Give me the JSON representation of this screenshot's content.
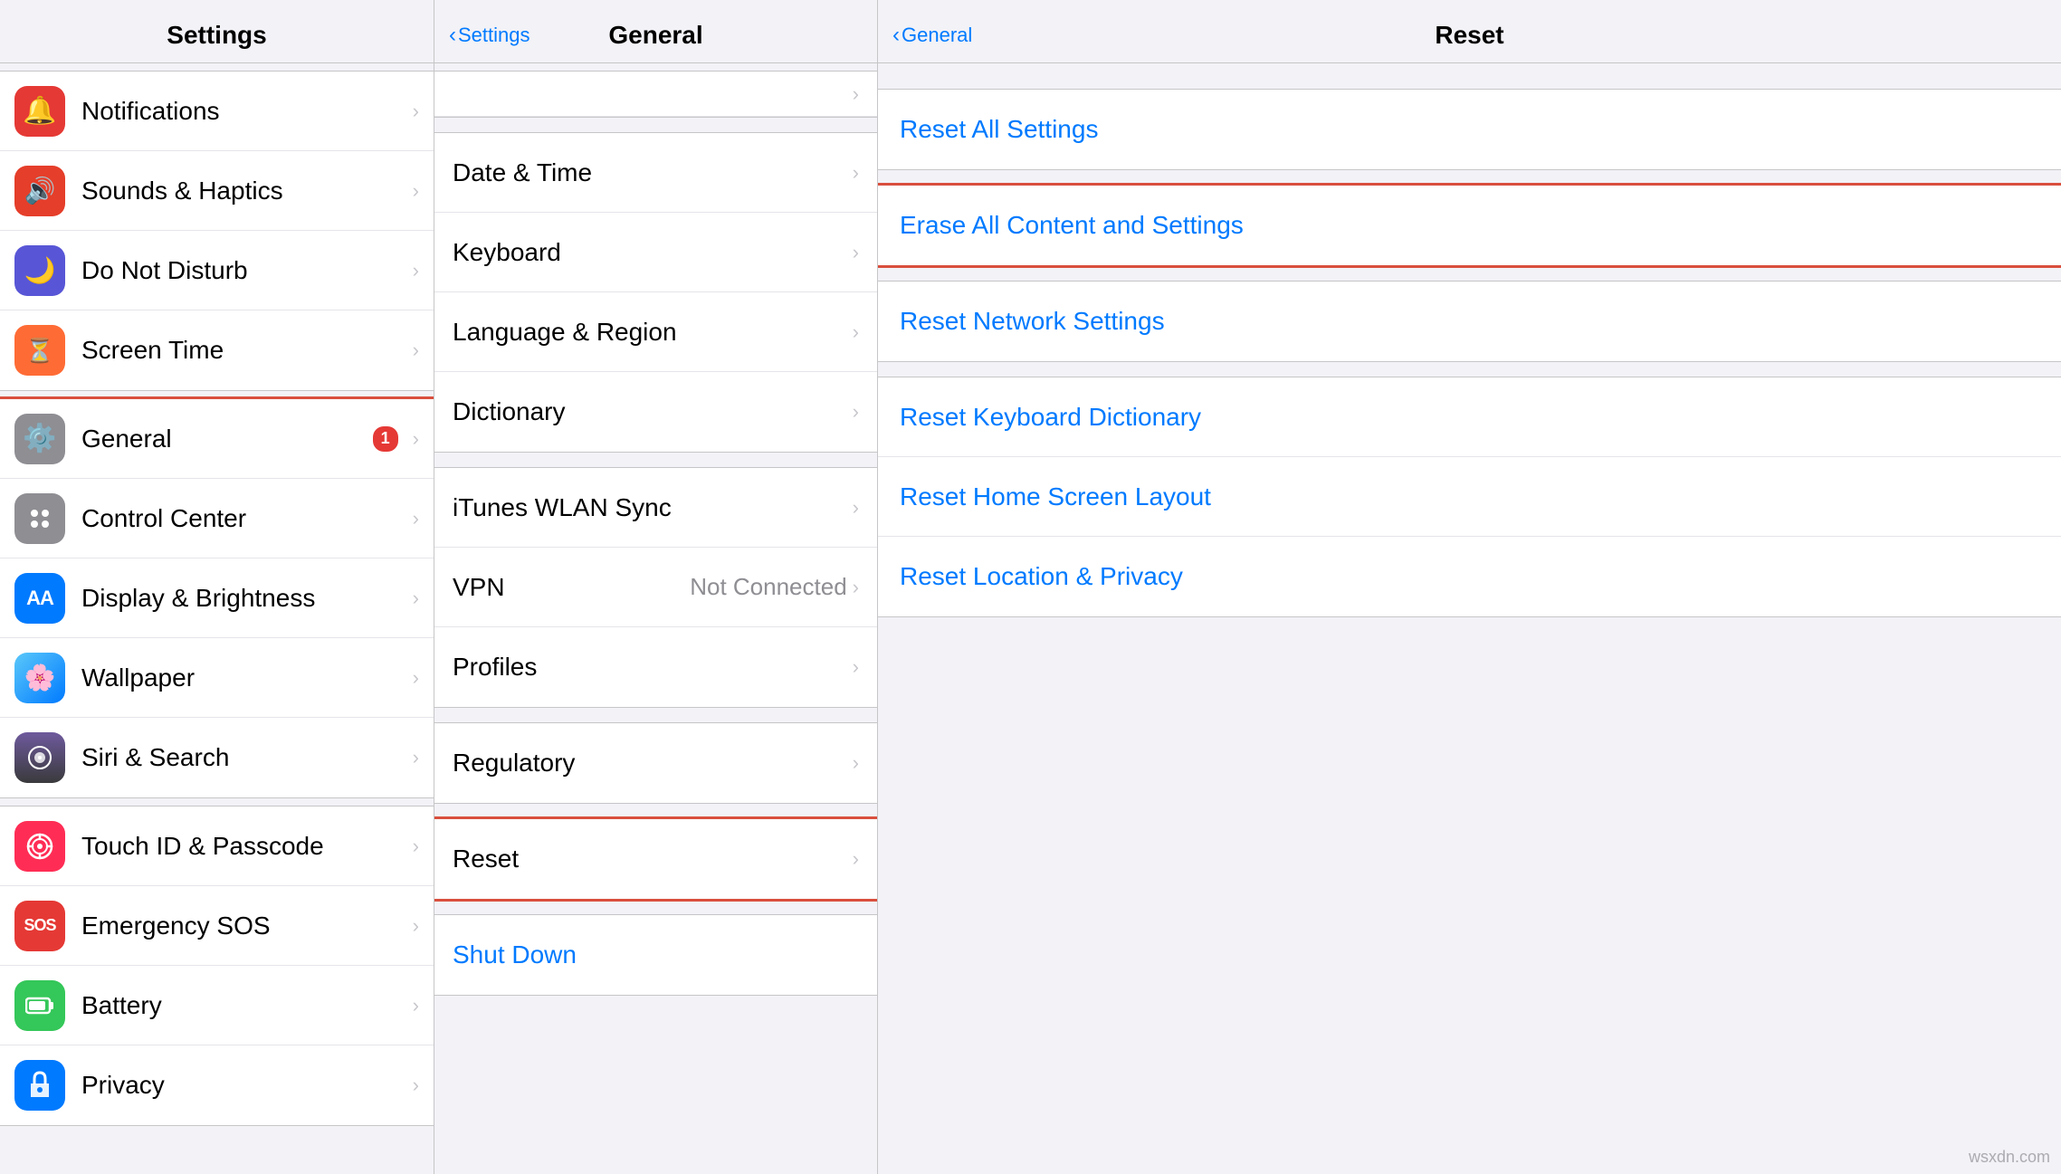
{
  "columns": {
    "settings": {
      "title": "Settings",
      "items": [
        {
          "id": "notifications",
          "label": "Notifications",
          "icon_bg": "icon-red",
          "icon_type": "bell",
          "selected": false
        },
        {
          "id": "sounds",
          "label": "Sounds & Haptics",
          "icon_bg": "icon-orange-red",
          "icon_type": "sound",
          "selected": false
        },
        {
          "id": "donotdisturb",
          "label": "Do Not Disturb",
          "icon_bg": "icon-purple",
          "icon_type": "moon",
          "selected": false
        },
        {
          "id": "screentime",
          "label": "Screen Time",
          "icon_bg": "icon-orange",
          "icon_type": "hourglass",
          "selected": false
        },
        {
          "id": "general",
          "label": "General",
          "icon_bg": "icon-gray",
          "icon_type": "gear",
          "badge": "1",
          "selected": true
        },
        {
          "id": "controlcenter",
          "label": "Control Center",
          "icon_bg": "icon-gray",
          "icon_type": "sliders",
          "selected": false
        },
        {
          "id": "displaybrightness",
          "label": "Display & Brightness",
          "icon_bg": "icon-blue",
          "icon_type": "aa",
          "selected": false
        },
        {
          "id": "wallpaper",
          "label": "Wallpaper",
          "icon_bg": "icon-teal",
          "icon_type": "flower",
          "selected": false
        },
        {
          "id": "siri",
          "label": "Siri & Search",
          "icon_bg": "icon-dark",
          "icon_type": "siri",
          "selected": false
        },
        {
          "id": "touchid",
          "label": "Touch ID & Passcode",
          "icon_bg": "icon-pink",
          "icon_type": "fingerprint",
          "selected": false
        },
        {
          "id": "emergencysos",
          "label": "Emergency SOS",
          "icon_bg": "icon-sos",
          "icon_type": "sos",
          "selected": false
        },
        {
          "id": "battery",
          "label": "Battery",
          "icon_bg": "icon-green",
          "icon_type": "battery",
          "selected": false
        },
        {
          "id": "privacy",
          "label": "Privacy",
          "icon_bg": "icon-blue",
          "icon_type": "hand",
          "selected": false
        }
      ]
    },
    "general": {
      "title": "General",
      "back_label": "Settings",
      "items_top": [
        {
          "id": "datetime",
          "label": "Date & Time",
          "value": ""
        },
        {
          "id": "keyboard",
          "label": "Keyboard",
          "value": ""
        },
        {
          "id": "language",
          "label": "Language & Region",
          "value": ""
        },
        {
          "id": "dictionary",
          "label": "Dictionary",
          "value": ""
        }
      ],
      "items_middle": [
        {
          "id": "itunes",
          "label": "iTunes WLAN Sync",
          "value": ""
        },
        {
          "id": "vpn",
          "label": "VPN",
          "value": "Not Connected"
        },
        {
          "id": "profiles",
          "label": "Profiles",
          "value": ""
        }
      ],
      "items_bottom": [
        {
          "id": "regulatory",
          "label": "Regulatory",
          "value": ""
        }
      ],
      "items_last": [
        {
          "id": "reset",
          "label": "Reset",
          "value": "",
          "selected": true
        }
      ],
      "shutdown_label": "Shut Down"
    },
    "reset": {
      "title": "Reset",
      "back_label": "General",
      "items": [
        {
          "id": "reset-all-settings",
          "label": "Reset All Settings",
          "selected": false
        },
        {
          "id": "erase-all",
          "label": "Erase All Content and Settings",
          "selected": true
        },
        {
          "id": "reset-network",
          "label": "Reset Network Settings",
          "selected": false
        },
        {
          "id": "reset-keyboard",
          "label": "Reset Keyboard Dictionary",
          "selected": false
        },
        {
          "id": "reset-home",
          "label": "Reset Home Screen Layout",
          "selected": false
        },
        {
          "id": "reset-location",
          "label": "Reset Location & Privacy",
          "selected": false
        }
      ]
    }
  },
  "watermark": "wsxdn.com"
}
